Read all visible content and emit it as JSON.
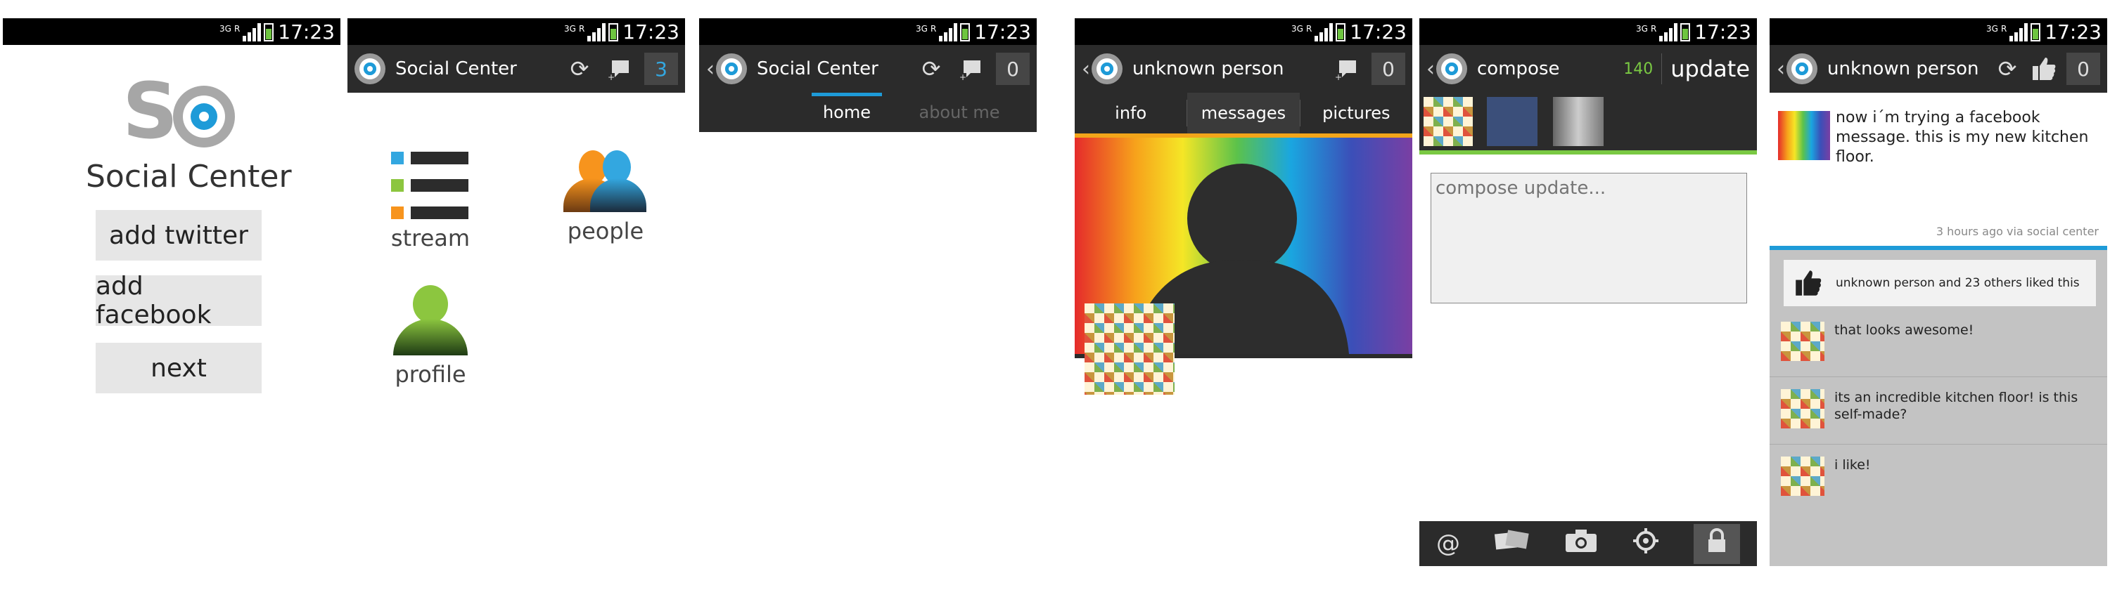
{
  "status_bar": {
    "net": "3G",
    "roaming": "R",
    "time": "17:23"
  },
  "splash": {
    "app_name": "Social Center",
    "buttons": [
      "add twitter",
      "add facebook",
      "next"
    ]
  },
  "dashboard": {
    "title": "Social Center",
    "counter": "3",
    "items": {
      "stream": "stream",
      "people": "people",
      "profile": "profile"
    }
  },
  "home": {
    "title": "Social Center",
    "counter": "0",
    "tabs": [
      "home",
      "about me"
    ]
  },
  "person": {
    "title": "unknown person",
    "counter": "0",
    "tabs": [
      "info",
      "messages",
      "pictures"
    ]
  },
  "compose": {
    "title": "compose",
    "char_count": "140",
    "update_label": "update",
    "placeholder": "compose update...",
    "bottom_icons": [
      "at-icon",
      "attach-icon",
      "camera-icon",
      "location-icon",
      "lock-icon"
    ]
  },
  "message": {
    "title": "unknown person",
    "counter": "0",
    "text": "now i´m trying a facebook message. this is my new kitchen floor.",
    "meta": "3 hours ago via social center",
    "likes": "unknown person and 23 others liked this",
    "comments": [
      "that looks awesome!",
      "its an incredible kitchen floor! is this self-made?",
      "i like!"
    ]
  },
  "colors": {
    "accent": "#1e9bd8",
    "bar": "#2b2b2b",
    "green": "#7ac943"
  }
}
